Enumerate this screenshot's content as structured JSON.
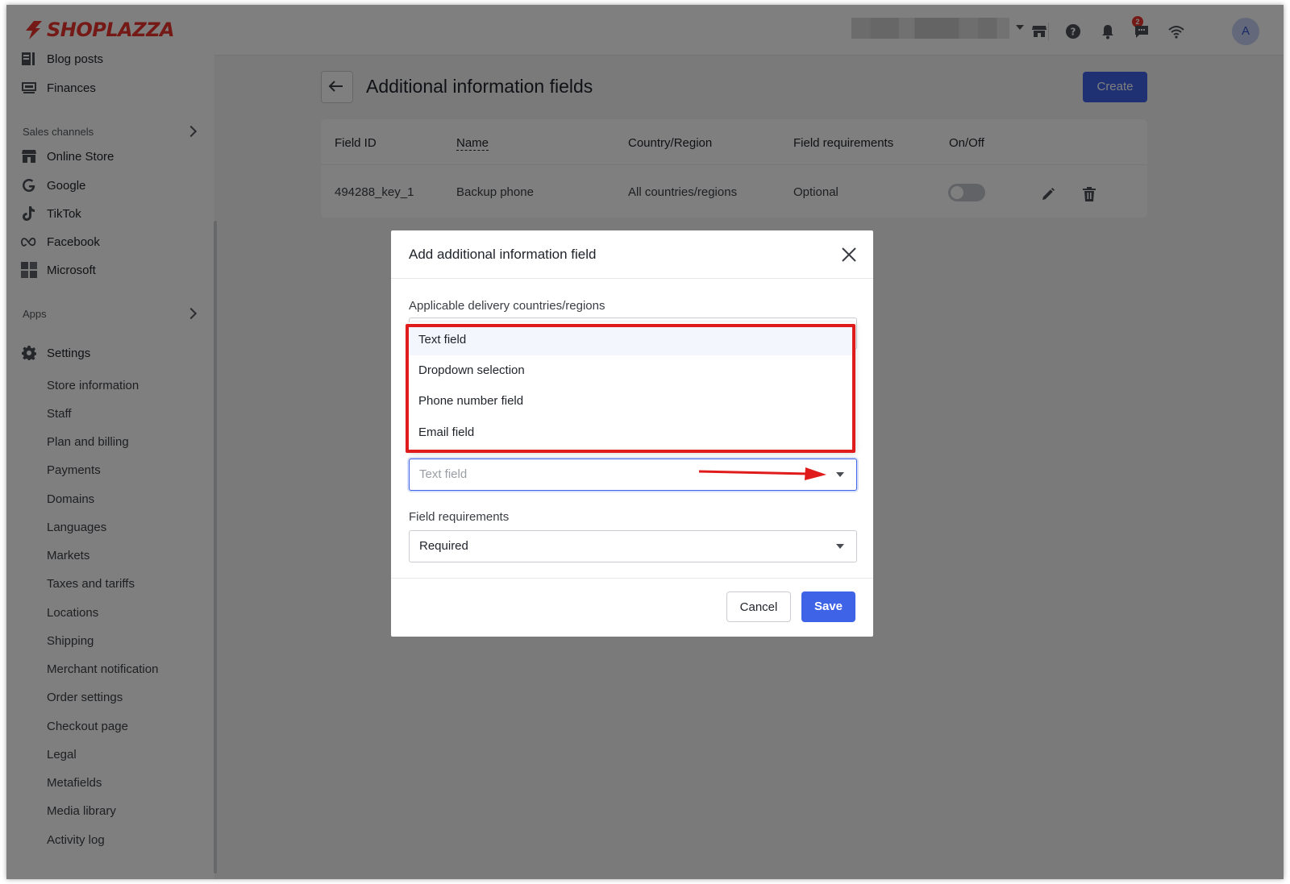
{
  "header": {
    "logo_text": "SHOPLAZZA",
    "notification_count": "2",
    "avatar_initial": "A",
    "icons": [
      "store-icon",
      "help-icon",
      "bell-icon",
      "chat-icon",
      "wifi-icon"
    ]
  },
  "sidebar": {
    "top_items": [
      {
        "label": "Blog posts",
        "icon": "blog-icon"
      },
      {
        "label": "Finances",
        "icon": "finances-icon"
      }
    ],
    "sales_channels_label": "Sales channels",
    "channels": [
      {
        "label": "Online Store",
        "icon": "store-icon"
      },
      {
        "label": "Google",
        "icon": "google-icon"
      },
      {
        "label": "TikTok",
        "icon": "tiktok-icon"
      },
      {
        "label": "Facebook",
        "icon": "meta-icon"
      },
      {
        "label": "Microsoft",
        "icon": "microsoft-icon"
      }
    ],
    "apps_label": "Apps",
    "settings_label": "Settings",
    "settings_items": [
      "Store information",
      "Staff",
      "Plan and billing",
      "Payments",
      "Domains",
      "Languages",
      "Markets",
      "Taxes and tariffs",
      "Locations",
      "Shipping",
      "Merchant notification",
      "Order settings",
      "Checkout page",
      "Legal",
      "Metafields",
      "Media library",
      "Activity log"
    ]
  },
  "page": {
    "title": "Additional information fields",
    "create_label": "Create",
    "table": {
      "headers": [
        "Field ID",
        "Name",
        "Country/Region",
        "Field requirements",
        "On/Off"
      ],
      "rows": [
        {
          "field_id": "494288_key_1",
          "name": "Backup phone",
          "country": "All countries/regions",
          "requirement": "Optional",
          "enabled": false
        }
      ]
    }
  },
  "modal": {
    "title": "Add additional information field",
    "countries_label": "Applicable delivery countries/regions",
    "field_type_options": [
      "Text field",
      "Dropdown selection",
      "Phone number field",
      "Email field"
    ],
    "field_type_placeholder": "Text field",
    "requirements_label": "Field requirements",
    "requirements_value": "Required",
    "cancel_label": "Cancel",
    "save_label": "Save"
  },
  "colors": {
    "brand": "#e8332b",
    "primary": "#3f63e6",
    "highlight": "#e01b1b"
  }
}
